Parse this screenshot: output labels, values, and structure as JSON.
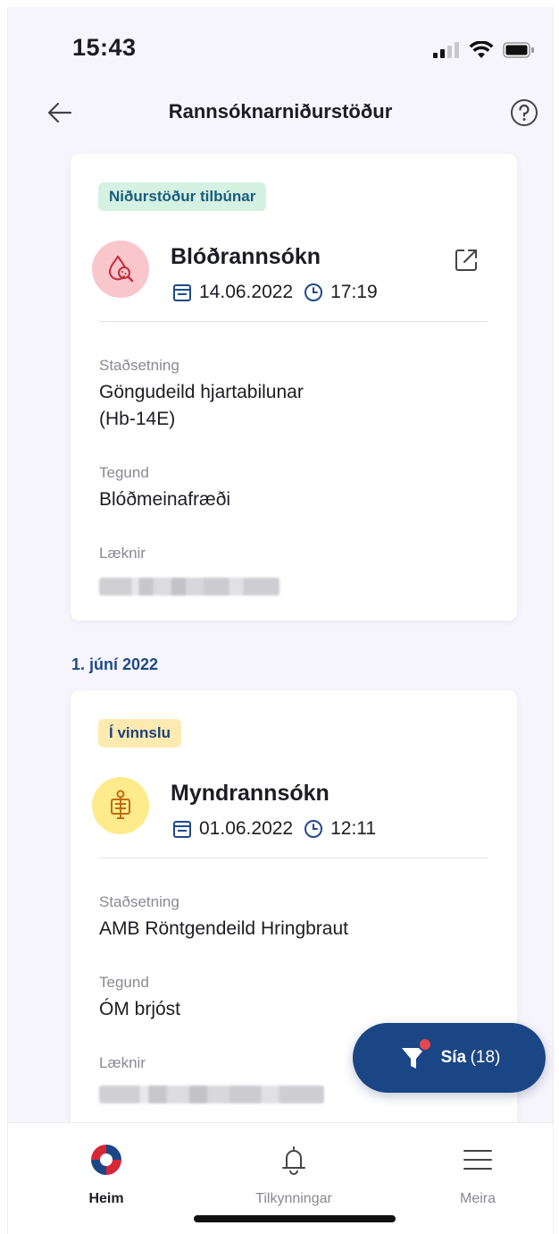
{
  "status_bar": {
    "time": "15:43"
  },
  "header": {
    "title": "Rannsóknarniðurstöður"
  },
  "results": [
    {
      "badge": "Niðurstöður tilbúnar",
      "title": "Blóðrannsókn",
      "date": "14.06.2022",
      "time": "17:19",
      "location_label": "Staðsetning",
      "location_line1": "Göngudeild hjartabilunar",
      "location_line2": "(Hb-14E)",
      "type_label": "Tegund",
      "type_value": "Blóðmeinafræði",
      "doctor_label": "Læknir"
    },
    {
      "badge": "Í vinnslu",
      "title": "Myndrannsókn",
      "date": "01.06.2022",
      "time": "12:11",
      "location_label": "Staðsetning",
      "location_line1": "AMB Röntgendeild Hringbraut",
      "type_label": "Tegund",
      "type_value": "ÓM brjóst",
      "doctor_label": "Læknir"
    }
  ],
  "section_date": "1. júní 2022",
  "filter": {
    "label": "Sía",
    "count": "(18)"
  },
  "nav": {
    "home": "Heim",
    "notifications": "Tilkynningar",
    "more": "Meira"
  },
  "colors": {
    "accent": "#1b4685",
    "ready_badge_bg": "#d4f1e2",
    "wip_badge_bg": "#fdeab0",
    "blood_icon_bg": "#f8c6cb",
    "imaging_icon_bg": "#fdeb8c",
    "notification_dot": "#e5484d"
  },
  "icons": {
    "back": "arrow-left-icon",
    "help": "question-circle-icon",
    "open": "external-link-icon",
    "date": "calendar-icon",
    "time": "clock-icon",
    "blood": "blood-drop-magnifier-icon",
    "imaging": "body-scan-icon",
    "filter": "funnel-icon",
    "home": "cross-logo-icon",
    "notifications": "bell-icon",
    "more": "menu-icon"
  }
}
